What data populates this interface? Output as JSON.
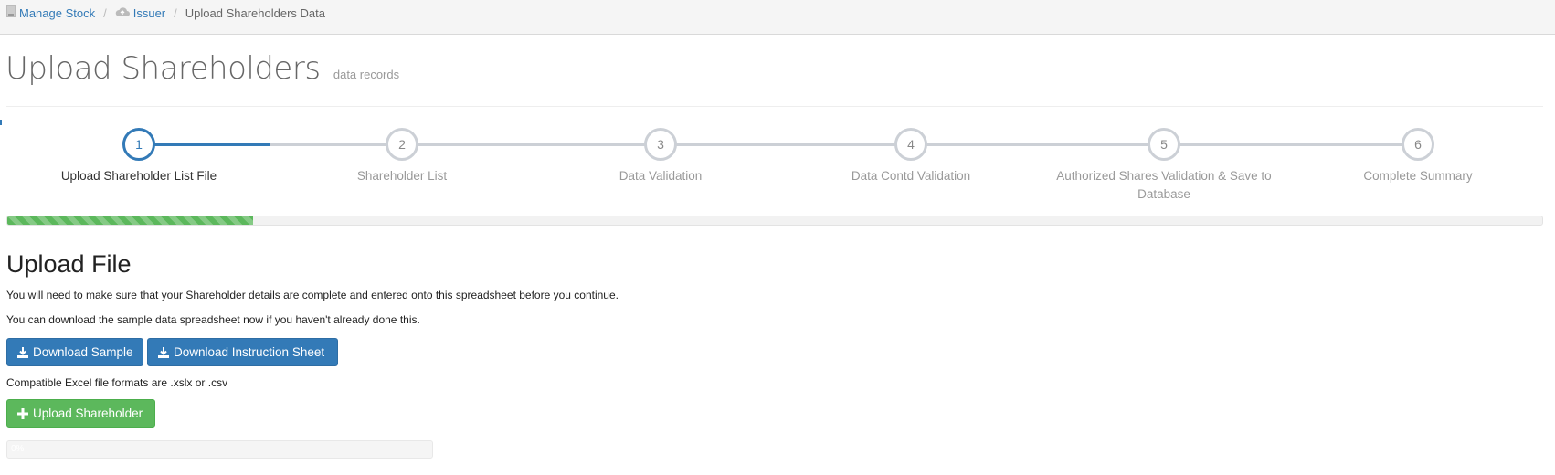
{
  "breadcrumb": {
    "items": [
      {
        "label": "Manage Stock",
        "icon": "document-icon"
      },
      {
        "label": "Issuer",
        "icon": "cloud-icon"
      },
      {
        "label": "Upload Shareholders Data"
      }
    ],
    "separator": "/"
  },
  "header": {
    "title": "Upload Shareholders",
    "subtitle": "data records"
  },
  "wizard": {
    "active_step": 1,
    "steps": [
      {
        "number": "1",
        "label": "Upload Shareholder List File"
      },
      {
        "number": "2",
        "label": "Shareholder List"
      },
      {
        "number": "3",
        "label": "Data Validation"
      },
      {
        "number": "4",
        "label": "Data Contd Validation"
      },
      {
        "number": "5",
        "label": "Authorized Shares Validation & Save to Database"
      },
      {
        "number": "6",
        "label": "Complete Summary"
      }
    ]
  },
  "progress": {
    "value": 0.16,
    "color": "#5cb85c"
  },
  "upload": {
    "title": "Upload File",
    "instruction": "You will need to make sure that your Shareholder details are complete and entered onto this spreadsheet before you continue.",
    "download_note": "You can download the sample data spreadsheet now if you haven't already done this.",
    "download_sample_label": "Download Sample",
    "download_instructions_label": "Download Instruction Sheet",
    "formats_note": "Compatible Excel file formats are .xslx or .csv",
    "upload_button_label": "Upload Shareholder",
    "upload_progress_text": "0%"
  },
  "colors": {
    "primary": "#337ab7",
    "success": "#5cb85c",
    "inactive_step": "#ccd0d6"
  }
}
